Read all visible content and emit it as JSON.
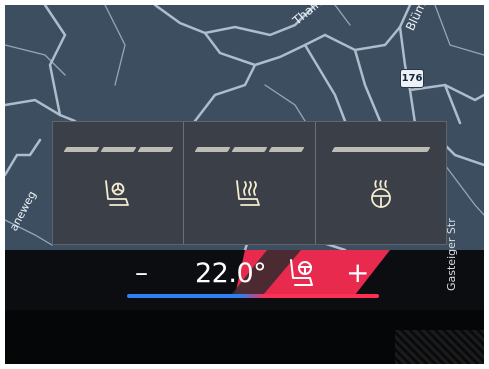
{
  "map": {
    "labels": {
      "street_top": "Thalho",
      "street_right": "Blüms",
      "street_left": "aneweg",
      "street_bottom_right": "Gasteiger Str"
    },
    "route_number": "176",
    "colors": {
      "background": "#3c4e5f",
      "roads": "#aebccb"
    }
  },
  "comfort_panel": {
    "tiles": [
      {
        "id": "seat-ventilation",
        "icon": "seat-fan-icon",
        "active_level_segments": 3
      },
      {
        "id": "seat-heating",
        "icon": "seat-heat-icon",
        "active_level_segments": 3
      },
      {
        "id": "steering-wheel-heating",
        "icon": "steering-wheel-heat-icon",
        "active_level_segments": 1
      }
    ]
  },
  "climate_bar": {
    "minus_label": "–",
    "temperature": "22.0°",
    "plus_label": "+",
    "seat_comfort_icon": "seat-comfort-icon",
    "colors": {
      "cold": "#2e7ff0",
      "hot": "#ff2e54"
    }
  }
}
